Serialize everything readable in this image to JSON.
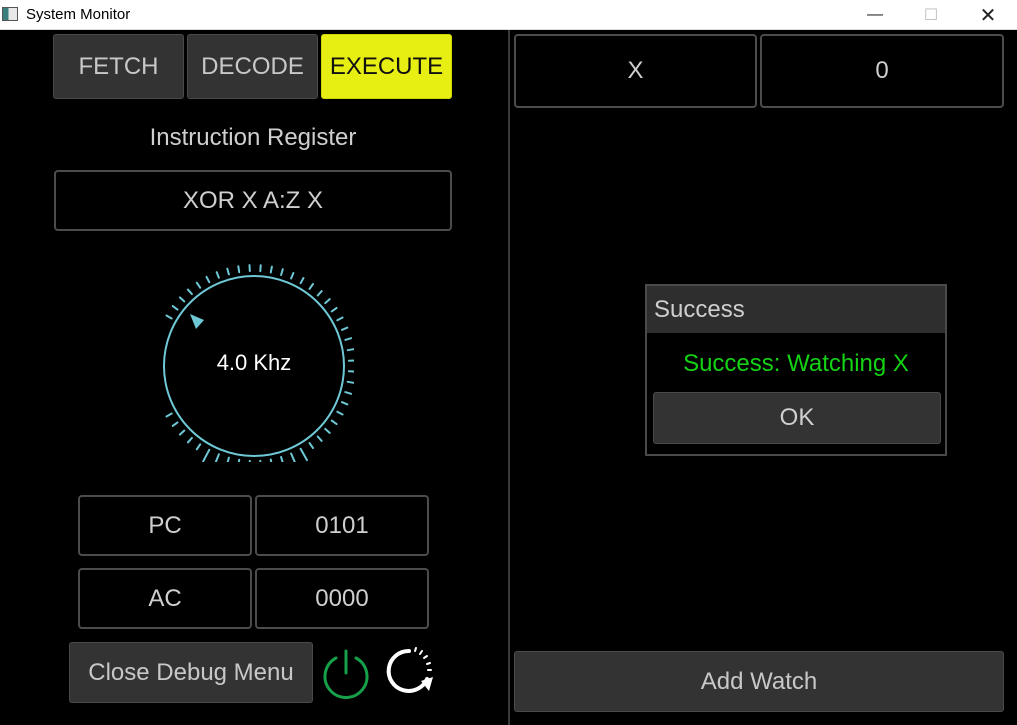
{
  "window": {
    "title": "System Monitor"
  },
  "stages": [
    {
      "label": "FETCH",
      "active": false
    },
    {
      "label": "DECODE",
      "active": false
    },
    {
      "label": "EXECUTE",
      "active": true
    }
  ],
  "instruction": {
    "heading": "Instruction Register",
    "value": "XOR X A:Z X"
  },
  "clock": {
    "label": "4.0 Khz"
  },
  "registers": [
    {
      "name": "PC",
      "value": "0101"
    },
    {
      "name": "AC",
      "value": "0000"
    }
  ],
  "controls": {
    "debug_label": "Close Debug Menu",
    "power_icon": "power-icon",
    "reset_icon": "restart-icon"
  },
  "watch": {
    "name": "X",
    "value": "0",
    "add_label": "Add Watch"
  },
  "dialog": {
    "title": "Success",
    "message": "Success: Watching X",
    "ok_label": "OK"
  },
  "colors": {
    "accent": "#e7ef12",
    "power": "#17a04a",
    "dial": "#6fc8d6",
    "success": "#14d314"
  }
}
